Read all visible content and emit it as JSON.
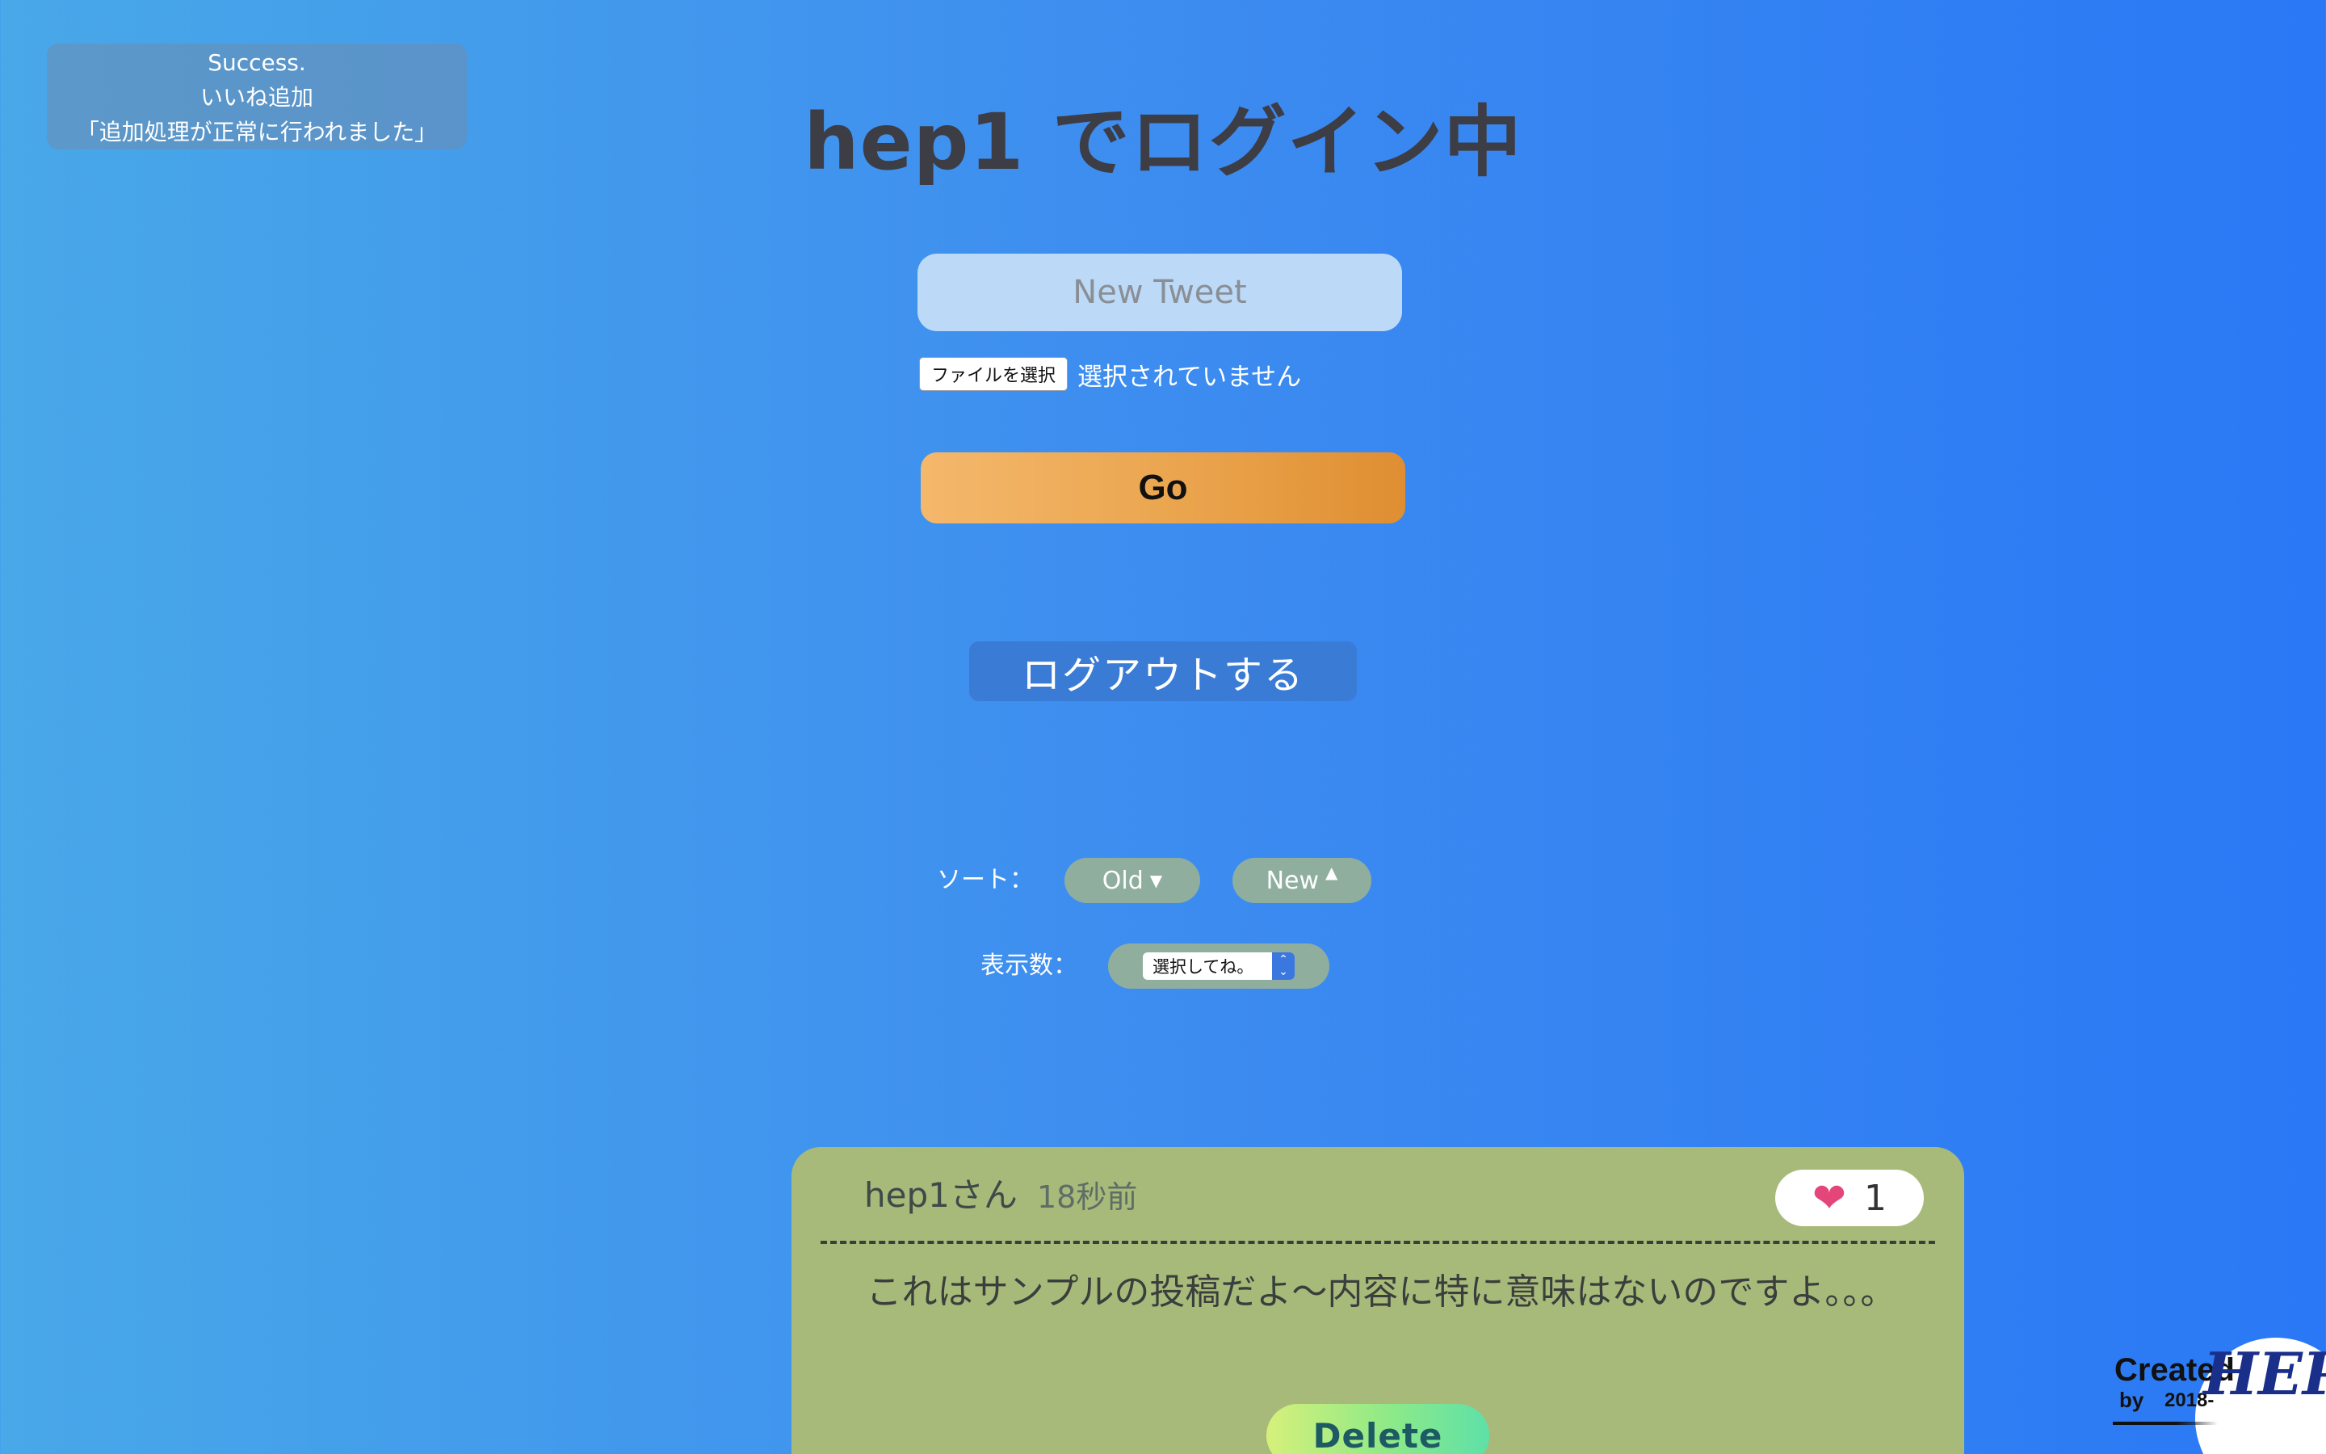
{
  "flash": {
    "line1": "Success.",
    "line2": "いいね追加",
    "line3": "「追加処理が正常に行われました」"
  },
  "header": {
    "title": "hep1 でログイン中"
  },
  "tweet_form": {
    "placeholder": "New Tweet",
    "file_button": "ファイルを選択",
    "file_status": "選択されていません",
    "submit_label": "Go"
  },
  "logout": {
    "label": "ログアウトする"
  },
  "sort": {
    "label": "ソート：",
    "old_label": "Old",
    "new_label": "New"
  },
  "display_count": {
    "label": "表示数：",
    "selected": "選択してね。"
  },
  "posts": [
    {
      "user": "hep1さん",
      "time": "18秒前",
      "likes": "1",
      "body": "これはサンプルの投稿だよ〜内容に特に意味はないのですよ。。。",
      "delete_label": "Delete"
    }
  ],
  "credit": {
    "created": "Created",
    "by": "by",
    "year": "2018-",
    "logo": "HEP!"
  },
  "colors": {
    "card_bg": "#a8ba7a",
    "heart": "#e5467a",
    "go_button": "#e9a24a",
    "pill": "#8fae9e"
  },
  "icons": [
    "heart-icon",
    "caret-down-icon",
    "caret-up-icon",
    "select-arrows-icon"
  ]
}
